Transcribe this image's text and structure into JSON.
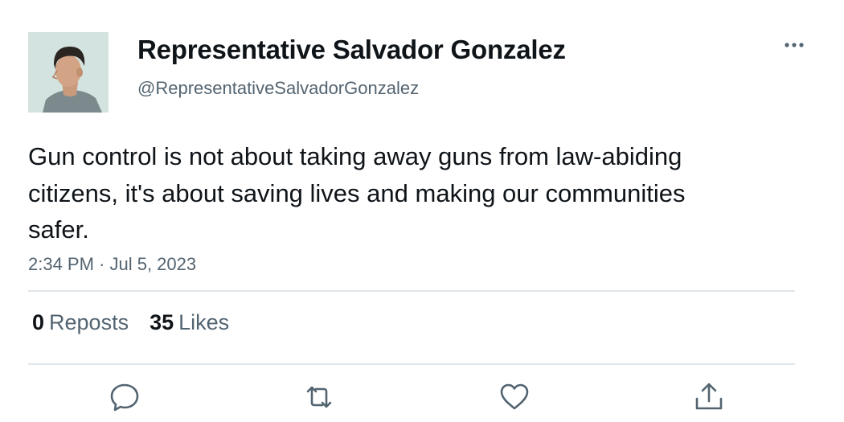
{
  "author": {
    "display_name": "Representative Salvador Gonzalez",
    "handle": "@RepresentativeSalvadorGonzalez",
    "avatar_icon": "profile-photo"
  },
  "tweet": {
    "text": "Gun control is not about taking away guns from law-abiding citizens, it's about saving lives and making our communities safer.",
    "timestamp": "2:34 PM · Jul 5, 2023"
  },
  "stats": {
    "reposts_count": "0",
    "reposts_label": "Reposts",
    "likes_count": "35",
    "likes_label": "Likes"
  },
  "actions": [
    {
      "icon": "reply-icon"
    },
    {
      "icon": "repost-icon"
    },
    {
      "icon": "like-icon"
    },
    {
      "icon": "share-icon"
    }
  ],
  "colors": {
    "text_primary": "#0f1419",
    "text_secondary": "#536471",
    "divider": "#e1e6ea",
    "icon": "#536471"
  }
}
